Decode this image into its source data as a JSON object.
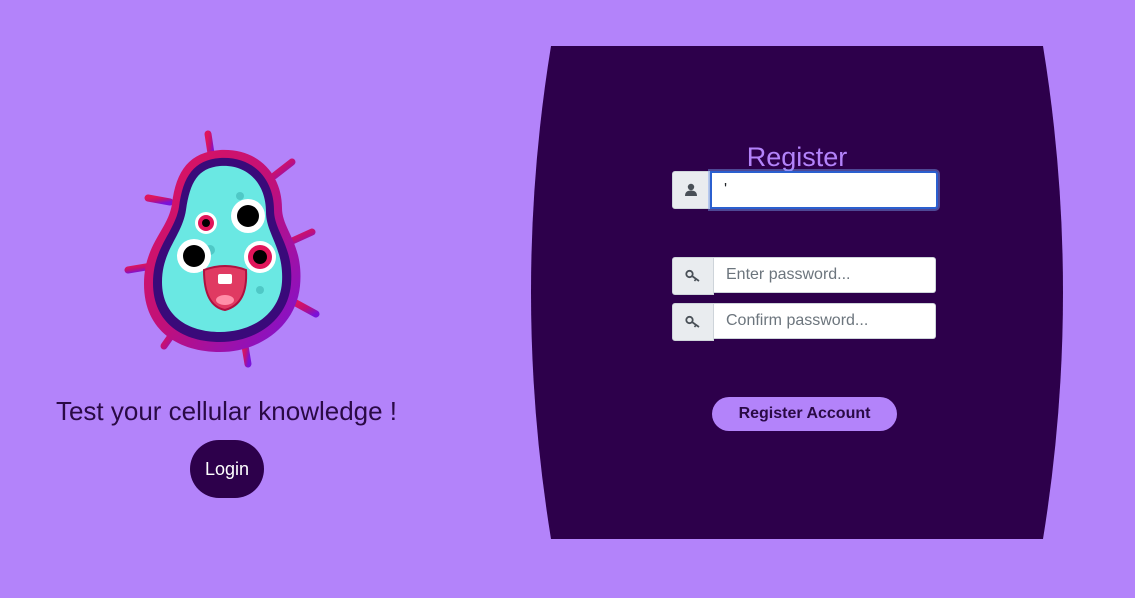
{
  "colors": {
    "background": "#b383fa",
    "card": "#2d004b",
    "accent": "#b383fa",
    "mascot_body": "#6ae8e3",
    "mascot_outline": "#3a0a7a",
    "mascot_aura": "#e0155a"
  },
  "hero": {
    "mascot_icon": "germ-mascot-icon",
    "tagline": "Test your cellular knowledge !",
    "login_label": "Login"
  },
  "register": {
    "title": "Register",
    "username": {
      "icon": "user-icon",
      "value": "'",
      "placeholder": ""
    },
    "password": {
      "icon": "key-icon",
      "value": "",
      "placeholder": "Enter password..."
    },
    "confirm": {
      "icon": "key-icon",
      "value": "",
      "placeholder": "Confirm password..."
    },
    "submit_label": "Register Account"
  }
}
